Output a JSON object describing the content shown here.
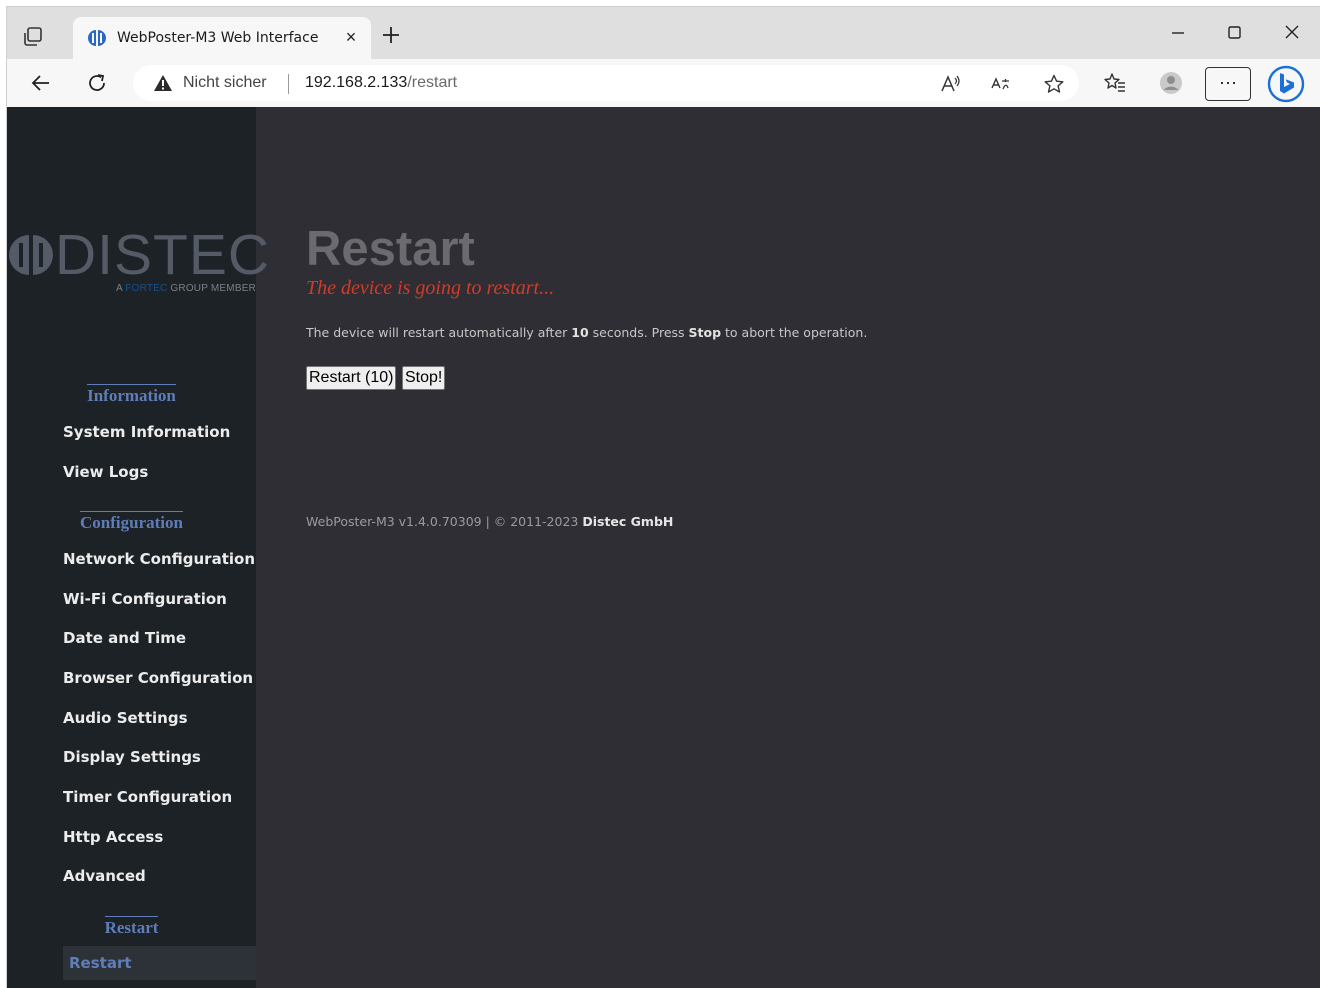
{
  "browser": {
    "tab_title": "WebPoster-M3 Web Interface",
    "tab_close": "×",
    "address": {
      "security_label": "Nicht sicher",
      "url_host": "192.168.2.133",
      "url_path": "/restart"
    },
    "settings_label": "···"
  },
  "sidebar": {
    "logo_text": "DISTEC",
    "logo_sub_prefix": "A ",
    "logo_sub_brand": "FORTEC",
    "logo_sub_suffix": " GROUP MEMBER",
    "sections": [
      {
        "title": "Information",
        "items": [
          "System Information",
          "View Logs"
        ]
      },
      {
        "title": "Configuration",
        "items": [
          "Network Configuration",
          "Wi-Fi Configuration",
          "Date and Time",
          "Browser Configuration",
          "Audio Settings",
          "Display Settings",
          "Timer Configuration",
          "Http Access",
          "Advanced"
        ]
      },
      {
        "title": "Restart",
        "items": [
          "Restart"
        ]
      }
    ]
  },
  "main": {
    "title": "Restart",
    "subtitle": "The device is going to restart...",
    "info_prefix": "The device will restart automatically after ",
    "info_seconds": "10",
    "info_middle": " seconds. Press ",
    "info_stop": "Stop",
    "info_suffix": " to abort the operation.",
    "restart_button": "Restart (10)",
    "stop_button": "Stop!",
    "footer_prefix": "WebPoster-M3 v1.4.0.70309 | © 2011-2023 ",
    "footer_brand": "Distec GmbH"
  },
  "colors": {
    "sidebar_bg": "#1c2226",
    "content_bg": "#2f2e35",
    "section_title": "#5f7db8",
    "subtitle": "#d23b28"
  }
}
